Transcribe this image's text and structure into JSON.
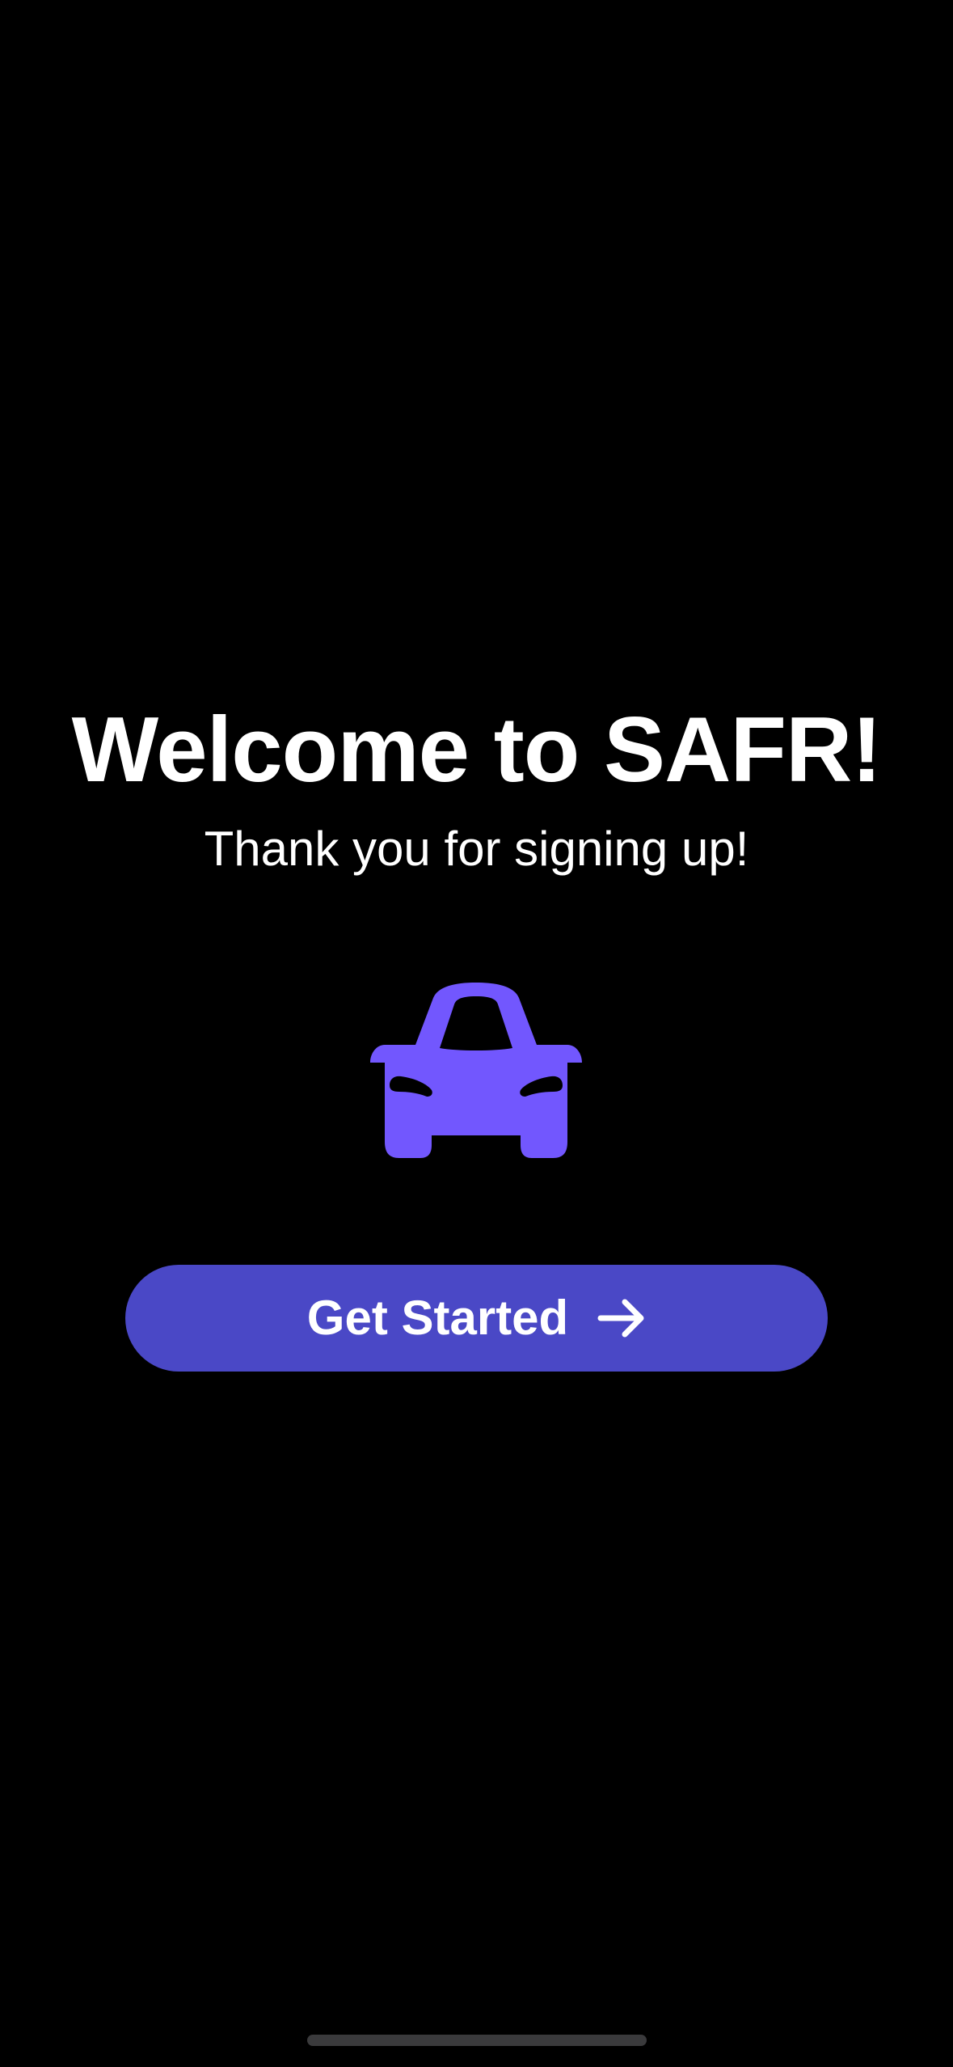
{
  "welcome": {
    "title": "Welcome to SAFR!",
    "subtitle": "Thank you for signing up!"
  },
  "hero": {
    "icon": "car-icon",
    "icon_color": "#7257fe"
  },
  "cta": {
    "label": "Get Started",
    "icon": "arrow-right-icon",
    "background": "#4a48c6"
  },
  "colors": {
    "background": "#000000",
    "text": "#ffffff"
  }
}
